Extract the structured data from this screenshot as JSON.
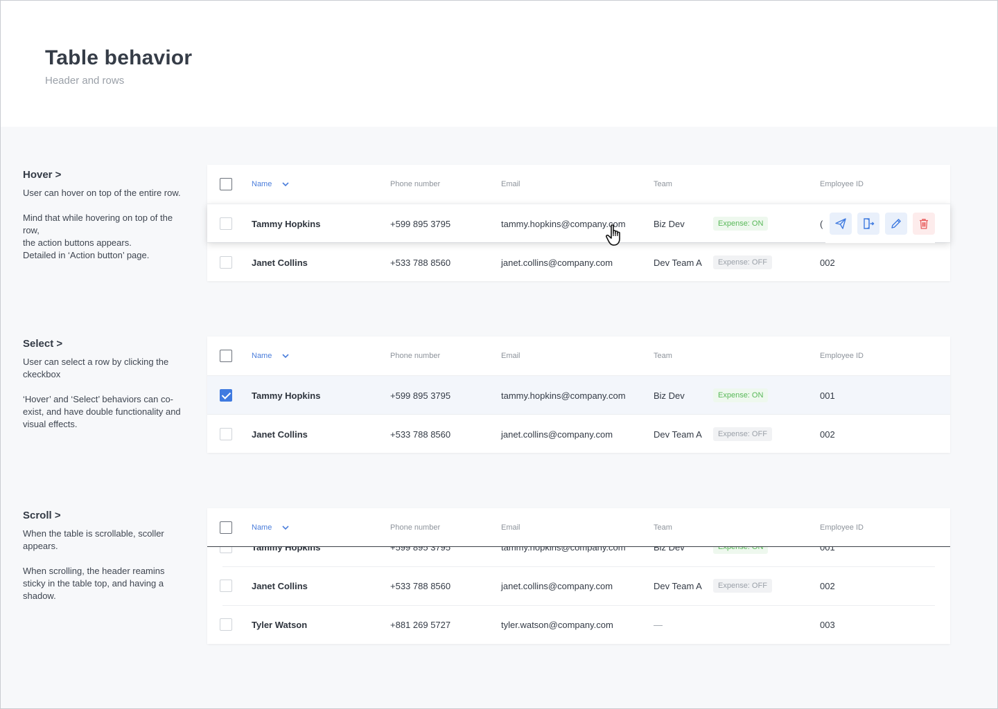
{
  "page": {
    "title": "Table behavior",
    "subtitle": "Header and rows"
  },
  "columns": {
    "name": "Name",
    "phone": "Phone number",
    "email": "Email",
    "team": "Team",
    "employee_id": "Employee ID"
  },
  "sections": {
    "hover": {
      "title": "Hover  >",
      "description": "User can hover on top of the entire row.\n\nMind that while hovering on top of the row,\nthe action buttons appears.\nDetailed in ‘Action button’ page."
    },
    "select": {
      "title": "Select  >",
      "description": "User can select a row by clicking the ckeckbox\n\n‘Hover’ and ‘Select’ behaviors can co-exist, and have double functionality and visual effects."
    },
    "scroll": {
      "title": "Scroll  >",
      "description": "When the table is scrollable, scoller appears.\n\nWhen scrolling, the header reamins sticky in the table top, and having a shadow."
    }
  },
  "rows": {
    "tammy": {
      "name": "Tammy Hopkins",
      "phone": "+599 895 3795",
      "email": "tammy.hopkins@company.com",
      "team": "Biz Dev",
      "expense": "Expense: ON",
      "employee_id": "001"
    },
    "janet": {
      "name": "Janet Collins",
      "phone": "+533 788 8560",
      "email": "janet.collins@company.com",
      "team": "Dev Team A",
      "expense": "Expense: OFF",
      "employee_id": "002"
    },
    "tyler": {
      "name": "Tyler Watson",
      "phone": "+881 269 5727",
      "email": "tyler.watson@company.com",
      "team": "—",
      "expense": "",
      "employee_id": "003"
    }
  },
  "hover_row_partial_id": "(",
  "actions": [
    "send-icon",
    "logout-icon",
    "pencil-icon",
    "trash-icon"
  ],
  "colors": {
    "accent": "#3f7ae0",
    "expense_on": "#58b858",
    "expense_off": "#9aa0a8",
    "danger": "#e85c5c"
  }
}
